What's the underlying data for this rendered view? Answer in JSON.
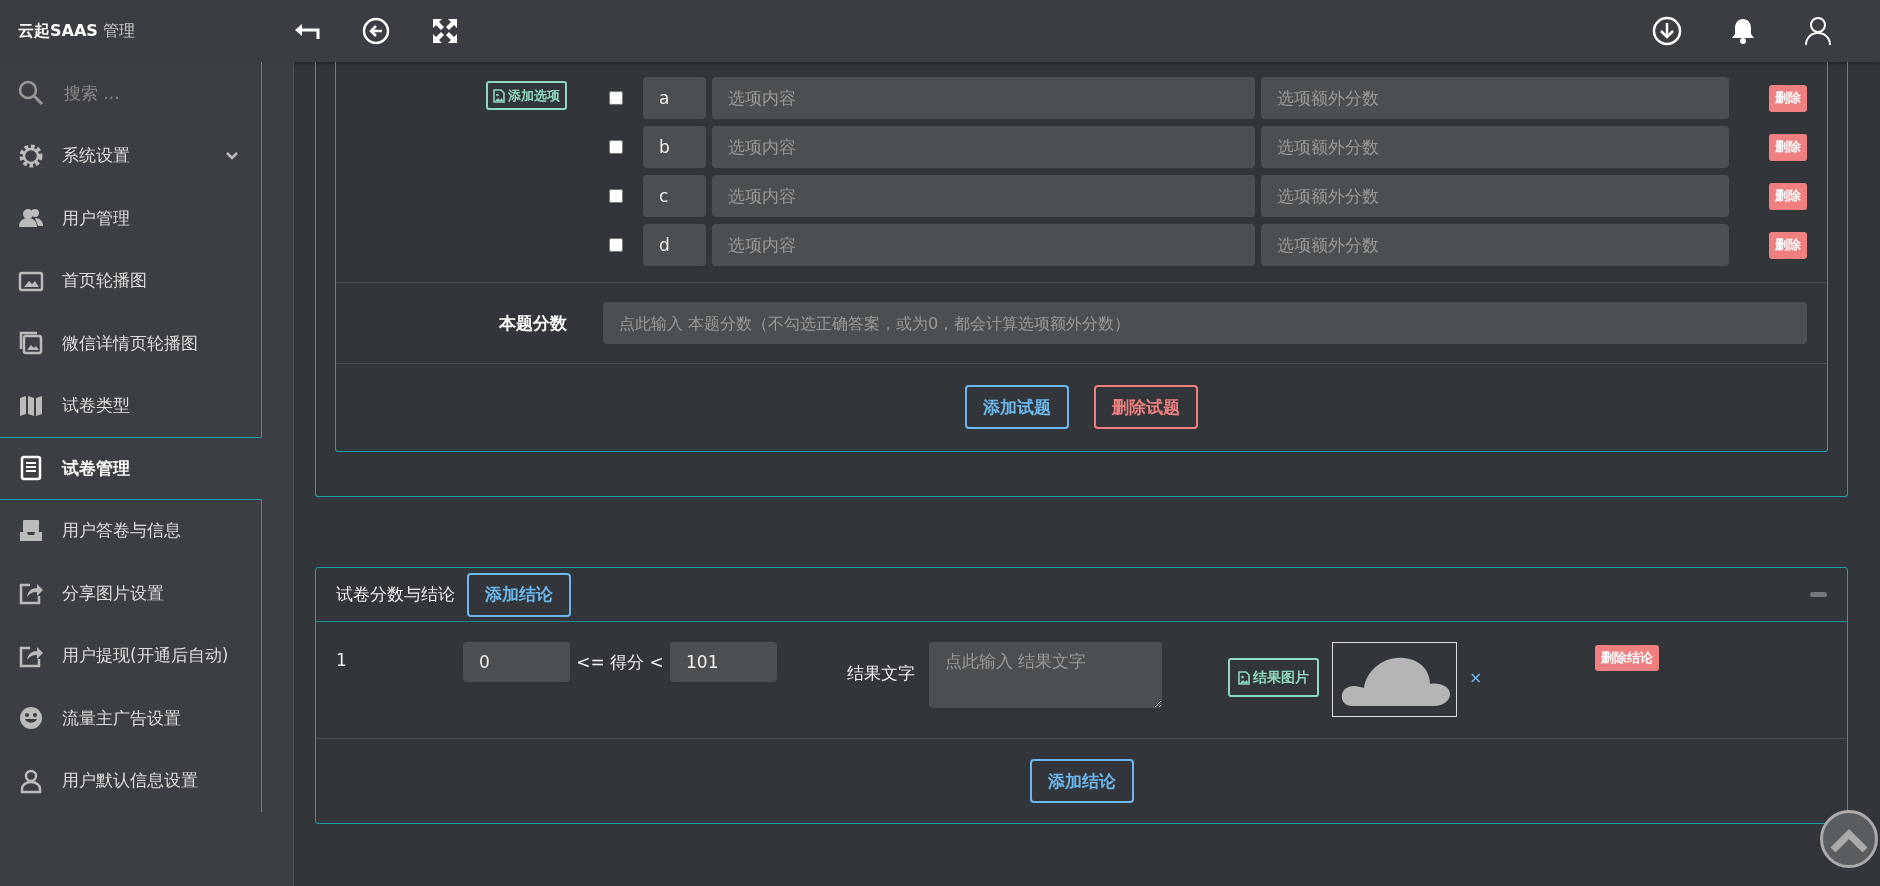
{
  "header": {
    "brand": "云起SAAS",
    "brand_suffix": "管理"
  },
  "sidebar": {
    "search_placeholder": "搜索 ...",
    "items": [
      {
        "label": "系统设置",
        "kind": "submenu",
        "selected": false
      },
      {
        "label": "用户管理",
        "kind": "link",
        "selected": false
      },
      {
        "label": "首页轮播图",
        "kind": "link",
        "selected": false
      },
      {
        "label": "微信详情页轮播图",
        "kind": "link",
        "selected": false
      },
      {
        "label": "试卷类型",
        "kind": "link",
        "selected": false
      },
      {
        "label": "试卷管理",
        "kind": "link",
        "selected": true
      },
      {
        "label": "用户答卷与信息",
        "kind": "link",
        "selected": false
      },
      {
        "label": "分享图片设置",
        "kind": "link",
        "selected": false
      },
      {
        "label": "用户提现(开通后自动)",
        "kind": "link",
        "selected": false
      },
      {
        "label": "流量主广告设置",
        "kind": "link",
        "selected": false
      },
      {
        "label": "用户默认信息设置",
        "kind": "link",
        "selected": false
      }
    ]
  },
  "question": {
    "add_option": "添加选项",
    "options": [
      {
        "checked": false,
        "letter": "a",
        "content_placeholder": "选项内容",
        "score_placeholder": "选项额外分数",
        "delete": "删除"
      },
      {
        "checked": false,
        "letter": "b",
        "content_placeholder": "选项内容",
        "score_placeholder": "选项额外分数",
        "delete": "删除"
      },
      {
        "checked": false,
        "letter": "c",
        "content_placeholder": "选项内容",
        "score_placeholder": "选项额外分数",
        "delete": "删除"
      },
      {
        "checked": false,
        "letter": "d",
        "content_placeholder": "选项内容",
        "score_placeholder": "选项额外分数",
        "delete": "删除"
      }
    ],
    "score_label": "本题分数",
    "score_placeholder": "点此输入 本题分数（不勾选正确答案，或为0，都会计算选项额外分数）",
    "add_question": "添加试题",
    "delete_question": "删除试题"
  },
  "conclusions": {
    "title": "试卷分数与结论",
    "add_button": "添加结论",
    "rows": [
      {
        "index": "1",
        "min": "0",
        "between": "<= 得分 <",
        "max": "101",
        "text_label": "结果文字",
        "text_placeholder": "点此输入 结果文字",
        "image_button": "结果图片",
        "remove_image": "×",
        "delete": "删除结论"
      }
    ],
    "footer_button": "添加结论"
  }
}
